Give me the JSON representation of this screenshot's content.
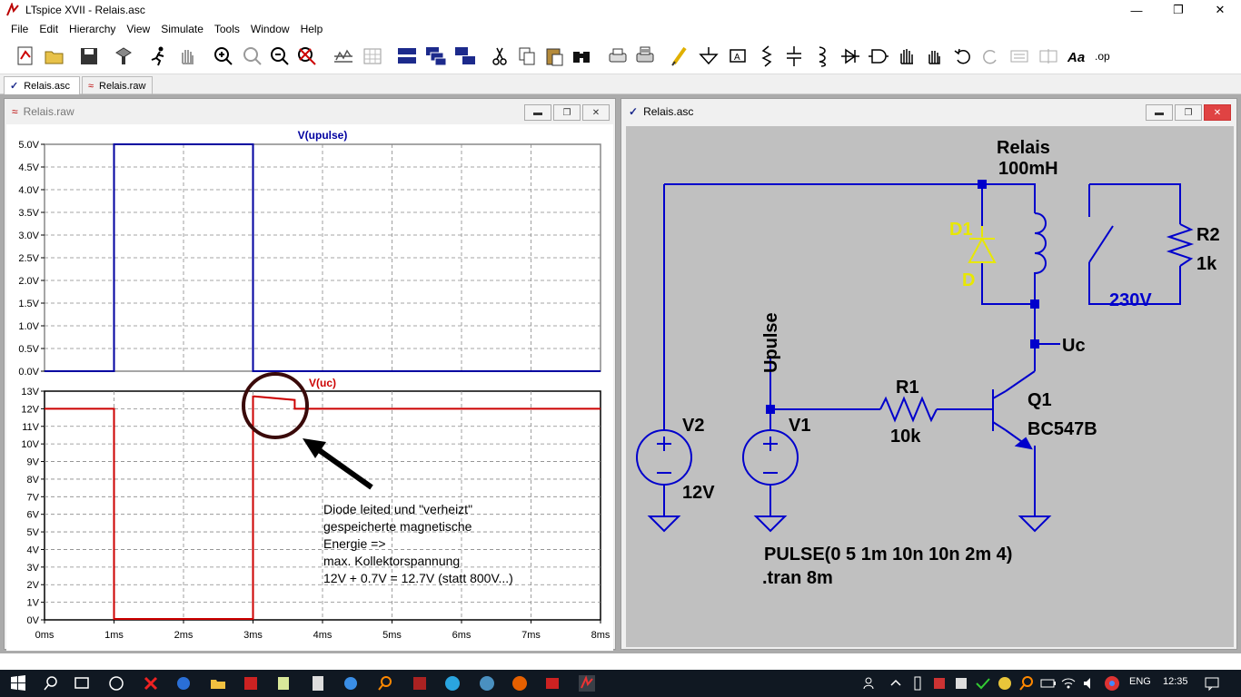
{
  "window": {
    "title": "LTspice XVII - Relais.asc"
  },
  "menu": [
    "File",
    "Edit",
    "Hierarchy",
    "View",
    "Simulate",
    "Tools",
    "Window",
    "Help"
  ],
  "tabs": [
    "Relais.asc",
    "Relais.raw"
  ],
  "plot_window": {
    "title": "Relais.raw",
    "top_pane": {
      "trace_label": "V(upulse)",
      "color": "#0000a0",
      "y_ticks": [
        "5.0V",
        "4.5V",
        "4.0V",
        "3.5V",
        "3.0V",
        "2.5V",
        "2.0V",
        "1.5V",
        "1.0V",
        "0.5V",
        "0.0V"
      ]
    },
    "bottom_pane": {
      "trace_label": "V(uc)",
      "color": "#cc0000",
      "y_ticks": [
        "13V",
        "12V",
        "11V",
        "10V",
        "9V",
        "8V",
        "7V",
        "6V",
        "5V",
        "4V",
        "3V",
        "2V",
        "1V",
        "0V"
      ]
    },
    "x_ticks": [
      "0ms",
      "1ms",
      "2ms",
      "3ms",
      "4ms",
      "5ms",
      "6ms",
      "7ms",
      "8ms"
    ],
    "annotation": [
      "Diode leited und \"verheizt\"",
      "gespeicherte magnetische",
      "Energie =>",
      "max. Kollektorspannung",
      "12V + 0.7V = 12.7V (statt 800V...)"
    ]
  },
  "chart_data": [
    {
      "type": "line",
      "title": "V(upulse)",
      "series": [
        {
          "name": "V(upulse)",
          "x": [
            0,
            1,
            1,
            3,
            3,
            8
          ],
          "y": [
            0,
            0,
            5,
            5,
            0,
            0
          ]
        }
      ],
      "xlim": [
        0,
        8
      ],
      "ylim": [
        0,
        5
      ],
      "x_unit": "ms",
      "y_unit": "V",
      "grid": true
    },
    {
      "type": "line",
      "title": "V(uc)",
      "series": [
        {
          "name": "V(uc)",
          "x": [
            0,
            1,
            1,
            3,
            3,
            3.02,
            3.6,
            3.6,
            8
          ],
          "y": [
            12,
            12,
            0.05,
            0.05,
            12.7,
            12.7,
            12.5,
            12,
            12
          ]
        }
      ],
      "xlim": [
        0,
        8
      ],
      "ylim": [
        0,
        13
      ],
      "x_unit": "ms",
      "y_unit": "V",
      "grid": true
    }
  ],
  "schematic_window": {
    "title": "Relais.asc",
    "labels": {
      "relay_name": "Relais",
      "relay_value": "100mH",
      "d1_name": "D1",
      "d1_value": "D",
      "r2_name": "R2",
      "r2_value": "1k",
      "v230": "230V",
      "uc": "Uc",
      "upulse": "Upulse",
      "r1_name": "R1",
      "r1_value": "10k",
      "q1_name": "Q1",
      "q1_value": "BC547B",
      "v2_name": "V2",
      "v2_value": "12V",
      "v1_name": "V1",
      "pulse": "PULSE(0 5 1m 10n 10n 2m 4)",
      "tran": ".tran 8m"
    }
  },
  "taskbar": {
    "language": "ENG",
    "time": "12:35"
  }
}
